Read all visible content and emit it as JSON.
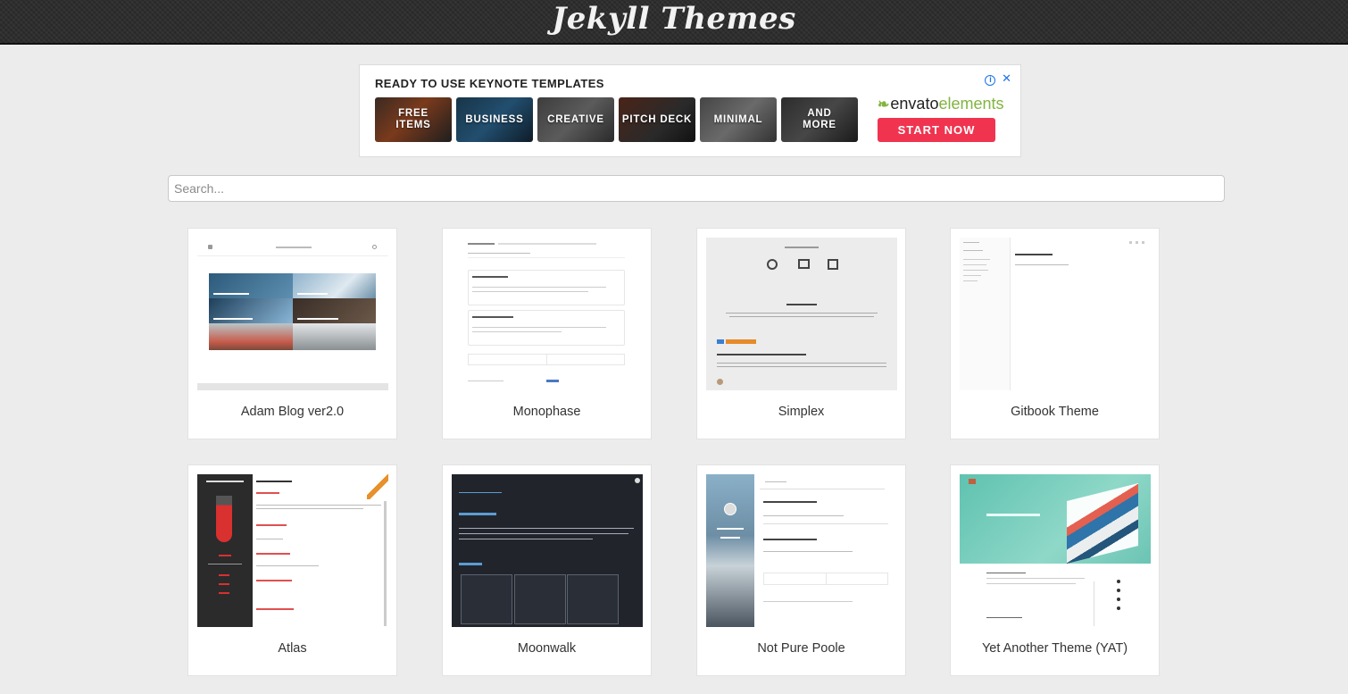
{
  "header": {
    "title": "Jekyll Themes"
  },
  "ad": {
    "headline": "READY TO USE KEYNOTE TEMPLATES",
    "tiles": [
      "FREE ITEMS",
      "BUSINESS",
      "CREATIVE",
      "PITCH DECK",
      "MINIMAL",
      "AND MORE"
    ],
    "brand_mark": "envato",
    "brand_sub": "elements",
    "cta": "START NOW",
    "info_icon": "i",
    "close_icon": "✕"
  },
  "search": {
    "placeholder": "Search..."
  },
  "themes": [
    {
      "name": "Adam Blog ver2.0"
    },
    {
      "name": "Monophase"
    },
    {
      "name": "Simplex"
    },
    {
      "name": "Gitbook Theme"
    },
    {
      "name": "Atlas"
    },
    {
      "name": "Moonwalk"
    },
    {
      "name": "Not Pure Poole"
    },
    {
      "name": "Yet Another Theme (YAT)"
    }
  ]
}
